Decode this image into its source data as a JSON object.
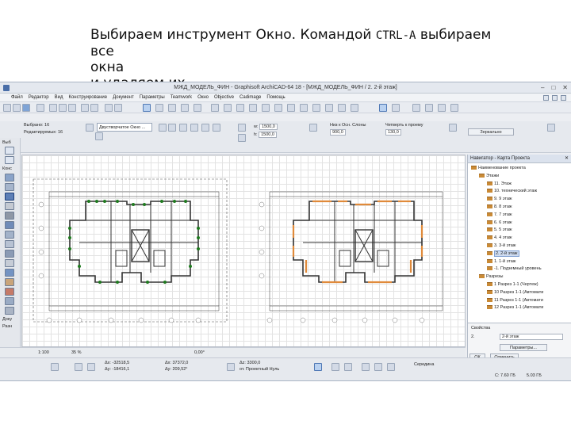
{
  "caption": {
    "line1_prefix": "Выбираем инструмент Окно. Командой ",
    "line1_mono": "CTRL-A",
    "line1_suffix": " выбираем все",
    "line2": "окна",
    "line3": "и удаляем их."
  },
  "window": {
    "title": "МЖД_МОДЕЛЬ_ФИН - Graphisoft ArchiCAD-64 18 - [МЖД_МОДЕЛЬ_ФИН / 2. 2-й этаж]",
    "controls": [
      "–",
      "□",
      "✕"
    ]
  },
  "menu": [
    "Файл",
    "Редактор",
    "Вид",
    "Конструирование",
    "Документ",
    "Параметры",
    "Teamwork",
    "Окно",
    "Objective",
    "Cadimage",
    "Помощь"
  ],
  "toolbar2": {
    "choose_label": "Выб:",
    "selected_label": "Выбрано: 16",
    "editable_label": "Редактируемых: 16",
    "combo_value": "Двустворчатое Окно ...",
    "w_value": "1500,0",
    "h_value": "1500,0",
    "sill_label": "Низ к Осн. Слоны",
    "sill_value": "900,0",
    "quarter_label": "Четверть к проему",
    "quarter_value": "130,0",
    "mirror_label": "Зеркально"
  },
  "toolbox": {
    "labels": [
      "Выб",
      "Конс",
      "Доку",
      "Разн"
    ]
  },
  "navigator": {
    "title": "Навигатор - Карта Проекта",
    "tree": [
      {
        "label": "Наименование проекта",
        "level": 0
      },
      {
        "label": "Этажи",
        "level": 1
      },
      {
        "label": "11. Этаж",
        "level": 2
      },
      {
        "label": "10. технический этаж",
        "level": 2
      },
      {
        "label": "9. 9 этаж",
        "level": 2
      },
      {
        "label": "8. 8 этаж",
        "level": 2
      },
      {
        "label": "7. 7 этаж",
        "level": 2
      },
      {
        "label": "6. 6 этаж",
        "level": 2
      },
      {
        "label": "5. 5 этаж",
        "level": 2
      },
      {
        "label": "4. 4 этаж",
        "level": 2
      },
      {
        "label": "3. 3-й этаж",
        "level": 2
      },
      {
        "label": "2. 2-й этаж",
        "level": 2,
        "selected": true
      },
      {
        "label": "1. 1-й этаж",
        "level": 2
      },
      {
        "label": "-1. Подземный уровень",
        "level": 2
      },
      {
        "label": "Разрезы",
        "level": 1
      },
      {
        "label": "1 Разрез 1-1 (Чертеж)",
        "level": 2
      },
      {
        "label": "10 Разрез 1-1 (Автомати",
        "level": 2
      },
      {
        "label": "11 Разрез 1-1 (Автомати",
        "level": 2
      },
      {
        "label": "12 Разрез 1-1 (Автомати",
        "level": 2
      }
    ],
    "props_title": "Свойства",
    "props_num": "2.",
    "props_name": "2-й этаж",
    "params_button": "Параметры...",
    "ok_button": "ОК",
    "cancel_button": "Отменить"
  },
  "status": {
    "scale": "1:100",
    "zoom": "35 %",
    "angle": "0,00°",
    "dx_label": "Δx:",
    "dx_value": "-32518,5",
    "dy_label": "Δy:",
    "dy_value": "-18416,1",
    "ax_label": "Δx:",
    "ax_value": "37372,0",
    "ay_label": "Δy:",
    "ay_value": "209,52°",
    "bz_label": "Δz:",
    "bz_value": "3300,0",
    "bz_ref": "от. Проектный Нуль",
    "middle_label": "Середина",
    "drive_c": "C: 7.60 ГБ",
    "drive_d": "5.03 ГБ"
  },
  "colors": {
    "selection_handle": "#1f7a1f",
    "window_highlight": "#e08a3a",
    "wall": "#333333",
    "grid": "#e3e3e3"
  }
}
